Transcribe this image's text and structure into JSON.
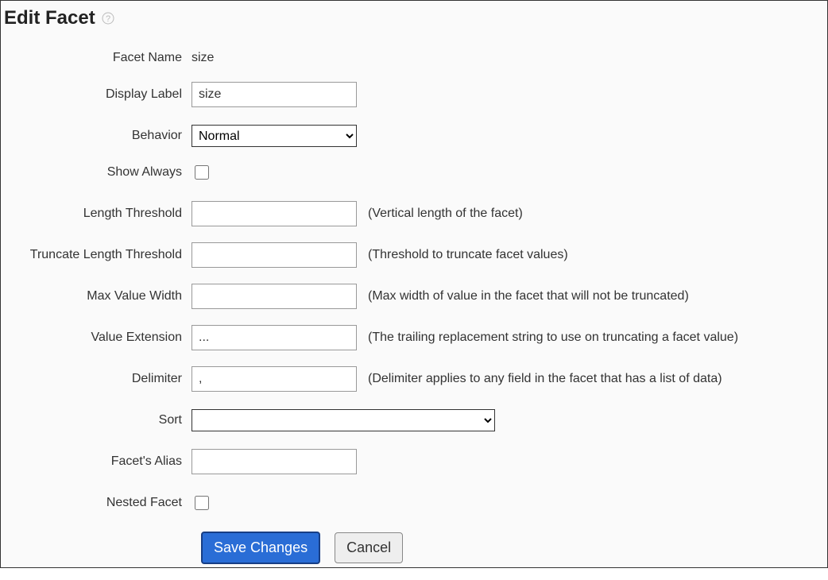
{
  "title": "Edit Facet",
  "labels": {
    "facet_name": "Facet Name",
    "display_label": "Display Label",
    "behavior": "Behavior",
    "show_always": "Show Always",
    "length_threshold": "Length Threshold",
    "truncate_length_threshold": "Truncate Length Threshold",
    "max_value_width": "Max Value Width",
    "value_extension": "Value Extension",
    "delimiter": "Delimiter",
    "sort": "Sort",
    "facets_alias": "Facet's Alias",
    "nested_facet": "Nested Facet"
  },
  "values": {
    "facet_name": "size",
    "display_label": "size",
    "behavior": "Normal",
    "show_always": false,
    "length_threshold": "",
    "truncate_length_threshold": "",
    "max_value_width": "",
    "value_extension": "...",
    "delimiter": ",",
    "sort": "",
    "facets_alias": "",
    "nested_facet": false
  },
  "hints": {
    "length_threshold": "(Vertical length of the facet)",
    "truncate_length_threshold": "(Threshold to truncate facet values)",
    "max_value_width": "(Max width of value in the facet that will not be truncated)",
    "value_extension": "(The trailing replacement string to use on truncating a facet value)",
    "delimiter": "(Delimiter applies to any field in the facet that has a list of data)"
  },
  "buttons": {
    "save": "Save Changes",
    "cancel": "Cancel"
  }
}
